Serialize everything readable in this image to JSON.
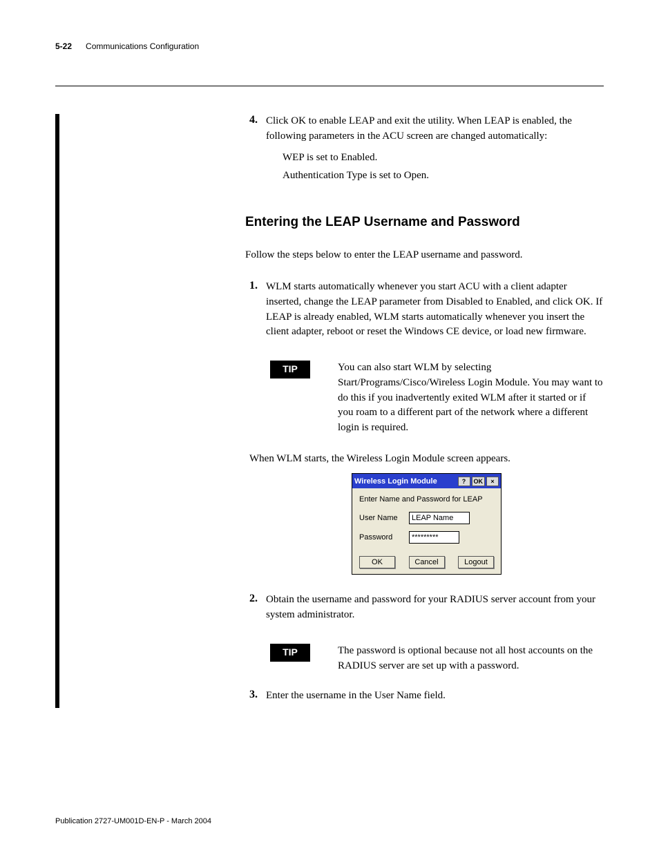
{
  "header": {
    "pagenum": "5-22",
    "section": "Communications Configuration"
  },
  "step4": {
    "num": "4.",
    "text": "Click OK to enable LEAP and exit the utility. When LEAP is enabled, the following parameters in the ACU screen are changed automatically:",
    "sub1": "WEP is set to Enabled.",
    "sub2": "Authentication Type is set to Open."
  },
  "heading": "Entering the LEAP Username and Password",
  "intro": "Follow the steps below to enter the LEAP username and password.",
  "step1": {
    "num": "1.",
    "text": "WLM starts automatically whenever you start ACU with a client adapter inserted, change the LEAP parameter from Disabled to Enabled, and click OK. If LEAP is already enabled, WLM starts automatically whenever you insert the client adapter, reboot or reset the Windows CE device, or load new firmware."
  },
  "tip1": {
    "label": "TIP",
    "text": "You can also start WLM by selecting Start/Programs/Cisco/Wireless Login Module. You may want to do this if you inadvertently exited WLM after it started or if you roam to a different part of the network where a different login is required."
  },
  "wlm_caption": "When WLM starts, the Wireless Login Module screen appears.",
  "wlm": {
    "title": "Wireless Login Module",
    "help": "?",
    "ok": "OK",
    "close": "×",
    "prompt": "Enter Name and Password for LEAP",
    "username_label": "User Name",
    "username_value": "LEAP Name",
    "password_label": "Password",
    "password_value": "*********",
    "btn_ok": "OK",
    "btn_cancel": "Cancel",
    "btn_logout": "Logout"
  },
  "step2": {
    "num": "2.",
    "text": "Obtain the username and password for your RADIUS server account from your system administrator."
  },
  "tip2": {
    "label": "TIP",
    "text": "The password is optional because not all host accounts on the RADIUS server are set up with a password."
  },
  "step3": {
    "num": "3.",
    "text": "Enter the username in the User Name field."
  },
  "footer": "Publication 2727-UM001D-EN-P - March 2004"
}
